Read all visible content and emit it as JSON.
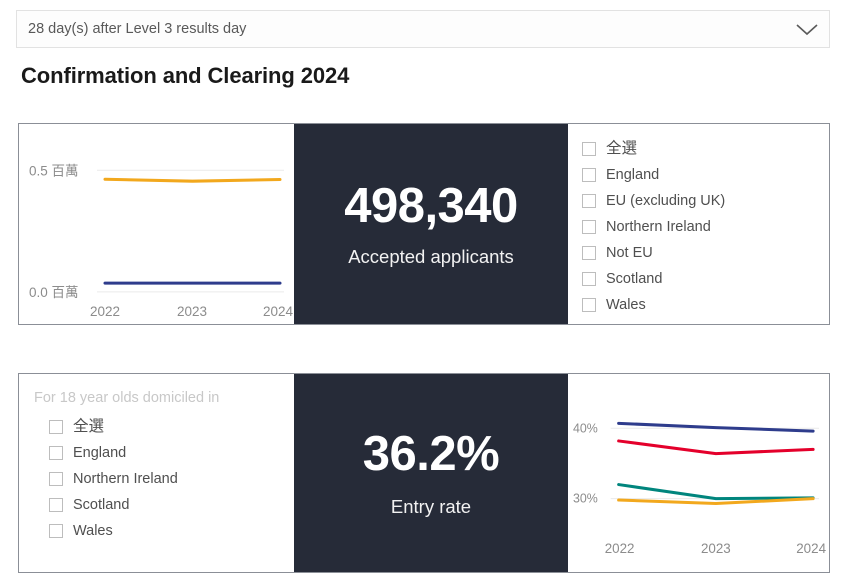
{
  "slicer": {
    "value": "28 day(s) after Level 3 results day",
    "icon": "chevron-down-icon"
  },
  "page": {
    "title": "Confirmation and Clearing 2024"
  },
  "card_top": {
    "kpi": {
      "value": "498,340",
      "caption": "Accepted applicants"
    },
    "filter_list": {
      "items": [
        {
          "label": "全選",
          "checked": false
        },
        {
          "label": "England",
          "checked": false
        },
        {
          "label": "EU (excluding UK)",
          "checked": false
        },
        {
          "label": "Northern Ireland",
          "checked": false
        },
        {
          "label": "Not EU",
          "checked": false
        },
        {
          "label": "Scotland",
          "checked": false
        },
        {
          "label": "Wales",
          "checked": false
        }
      ]
    }
  },
  "card_bottom": {
    "kpi": {
      "value": "36.2%",
      "caption": "Entry rate"
    },
    "filter_list": {
      "header": "For 18 year olds domiciled in",
      "items": [
        {
          "label": "全選",
          "checked": false
        },
        {
          "label": "England",
          "checked": false
        },
        {
          "label": "Northern Ireland",
          "checked": false
        },
        {
          "label": "Scotland",
          "checked": false
        },
        {
          "label": "Wales",
          "checked": false
        }
      ]
    }
  },
  "chart_data": [
    {
      "id": "accepted-applicants-trend",
      "type": "line",
      "title": "",
      "xlabel": "",
      "ylabel": "",
      "x": [
        "2022",
        "2023",
        "2024"
      ],
      "ytick_labels": [
        "0.0 百萬",
        "0.5 百萬"
      ],
      "ytick_values": [
        0.0,
        0.5
      ],
      "ylim": [
        0.0,
        0.56
      ],
      "unit": "millions",
      "grid": true,
      "legend": "none",
      "series": [
        {
          "name": "series-orange",
          "color": "#f2a81d",
          "values": [
            0.463,
            0.455,
            0.462
          ]
        },
        {
          "name": "series-navy",
          "color": "#2e3c8c",
          "values": [
            0.036,
            0.036,
            0.036
          ]
        }
      ]
    },
    {
      "id": "entry-rate-trend",
      "type": "line",
      "title": "",
      "xlabel": "",
      "ylabel": "",
      "x": [
        "2022",
        "2023",
        "2024"
      ],
      "ytick_labels": [
        "30%",
        "40%"
      ],
      "ytick_values": [
        30,
        40
      ],
      "ylim": [
        27.5,
        42.5
      ],
      "unit": "percent",
      "grid": true,
      "legend": "none",
      "series": [
        {
          "name": "series-navy",
          "color": "#2e3c8c",
          "values": [
            40.7,
            40.1,
            39.6
          ]
        },
        {
          "name": "series-red",
          "color": "#e4002b",
          "values": [
            38.2,
            36.4,
            37.0
          ]
        },
        {
          "name": "series-teal",
          "color": "#00857d",
          "values": [
            32.0,
            30.0,
            30.1
          ]
        },
        {
          "name": "series-orange",
          "color": "#f2a81d",
          "values": [
            29.8,
            29.3,
            30.0
          ]
        }
      ]
    }
  ]
}
